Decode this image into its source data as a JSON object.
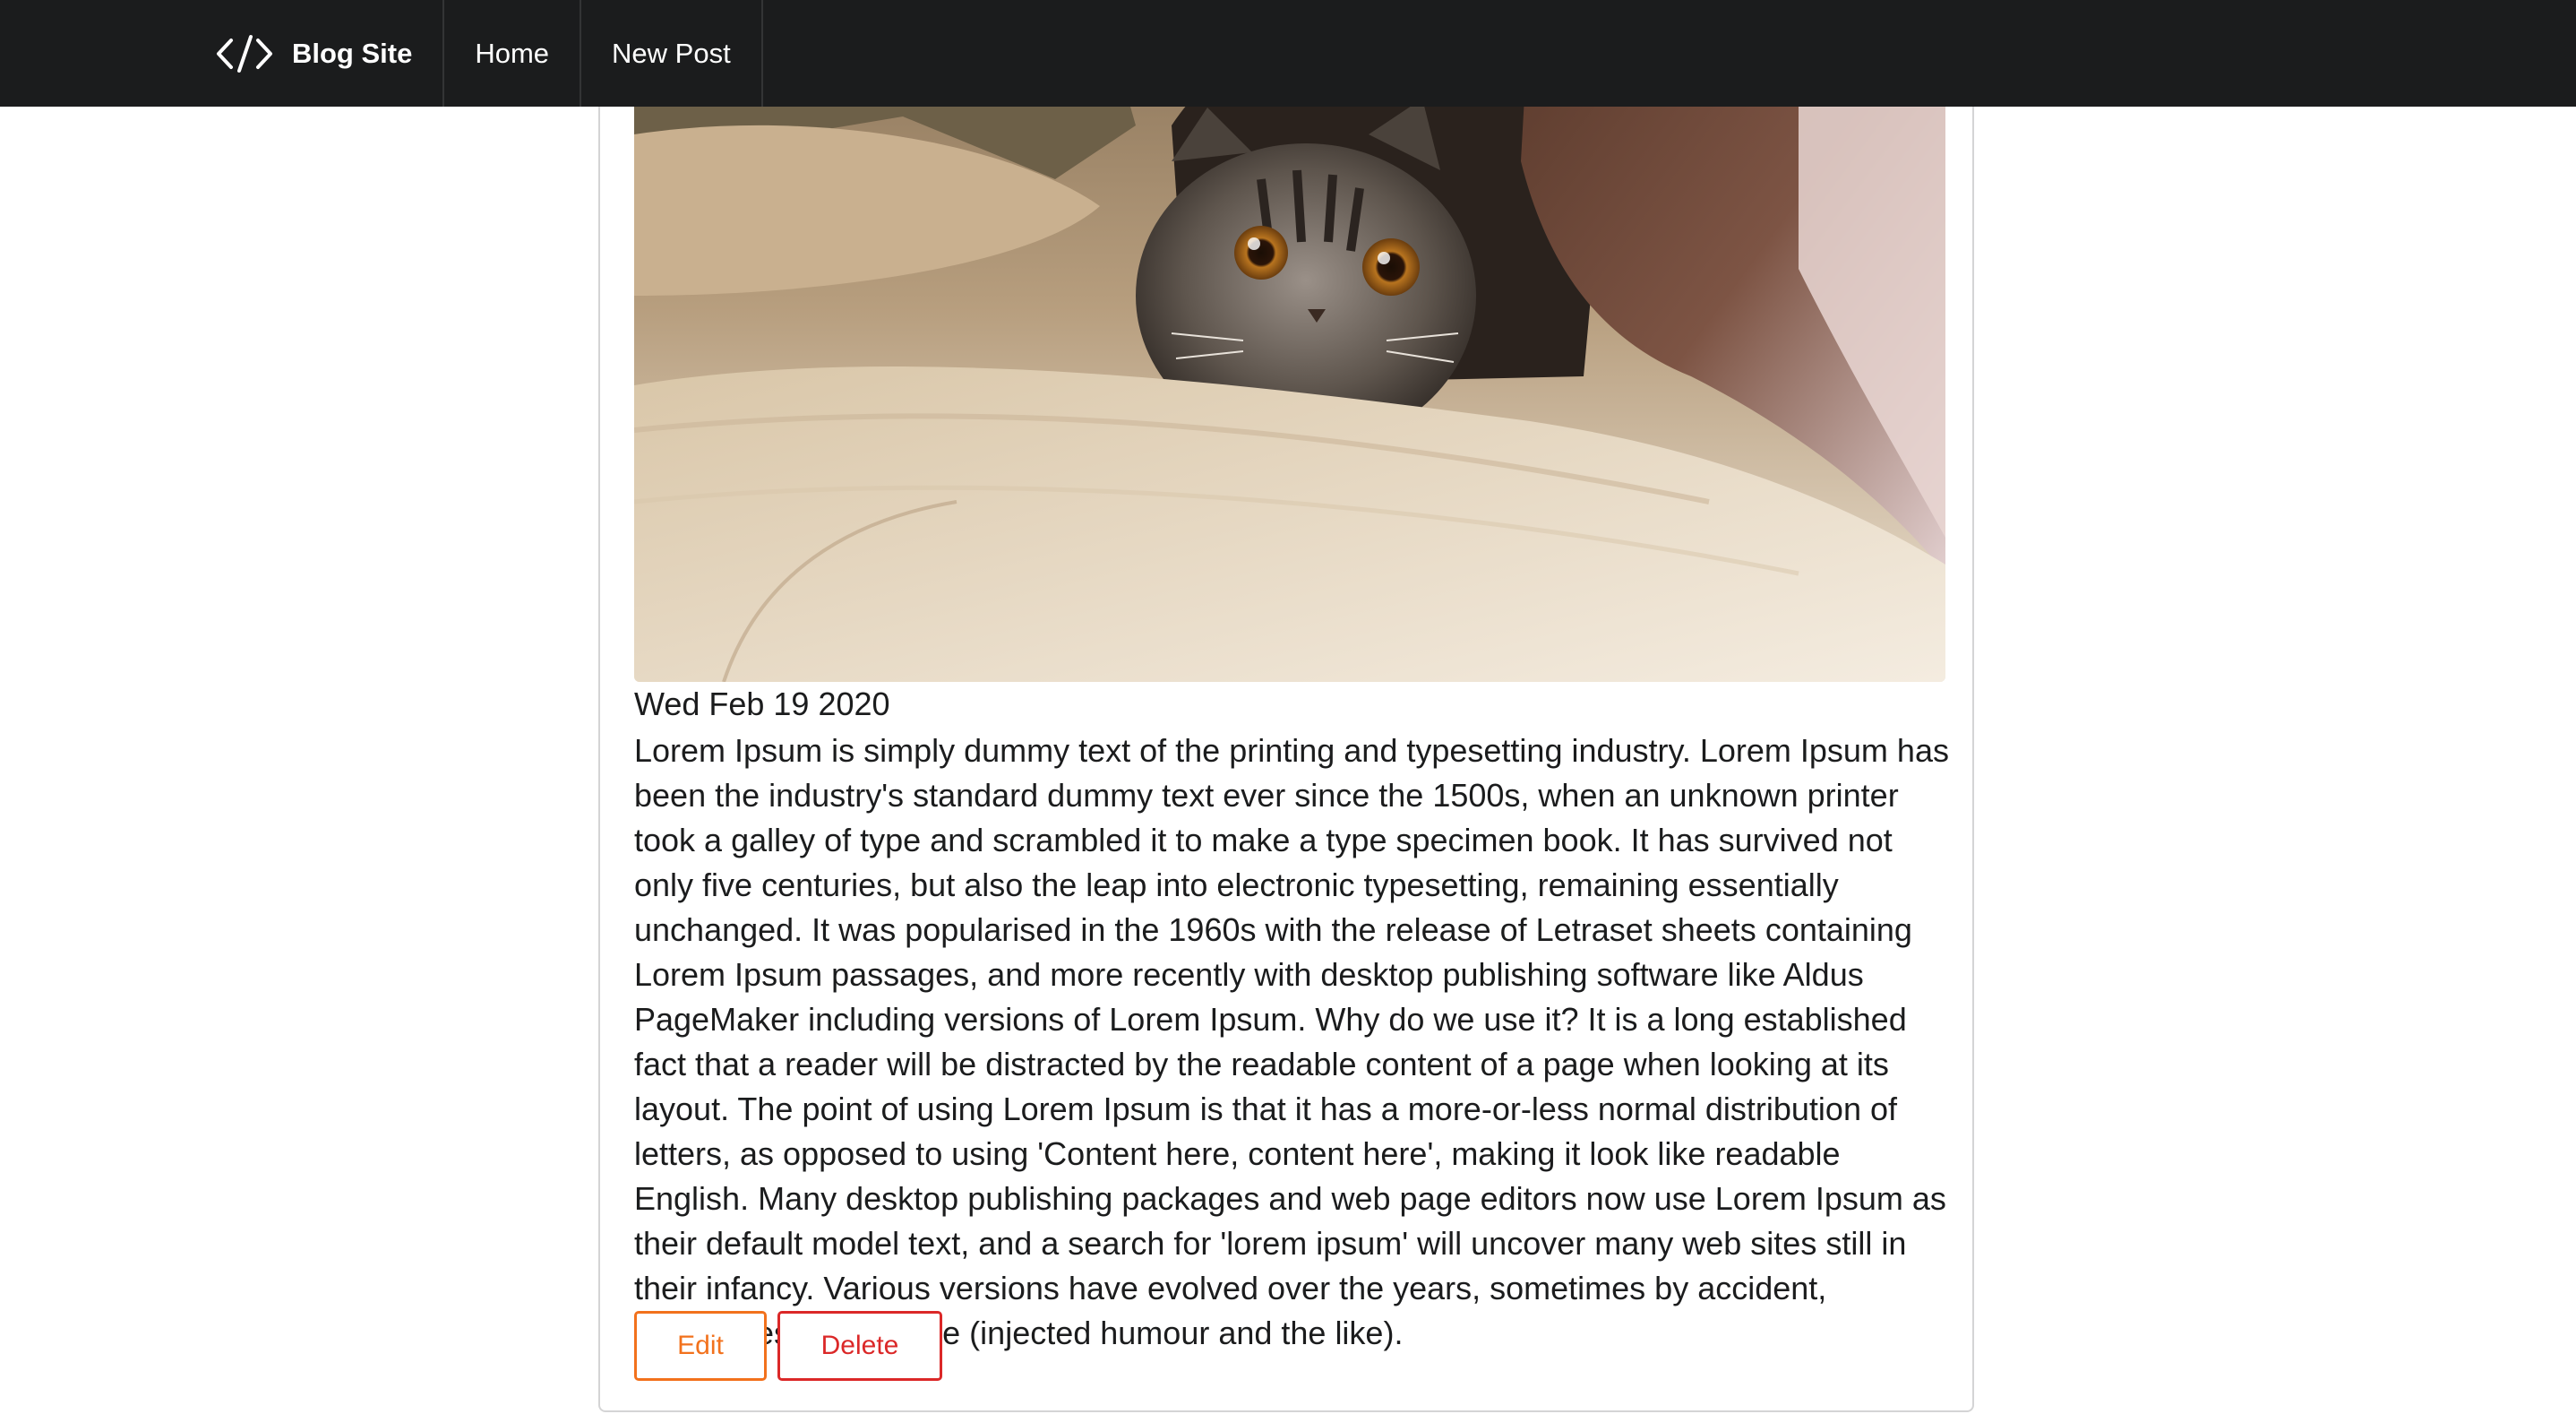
{
  "navbar": {
    "brand_icon": "code-icon",
    "brand_label": "Blog Site",
    "items": [
      {
        "label": "Home"
      },
      {
        "label": "New Post"
      }
    ]
  },
  "post": {
    "image_subject": "cat-photo",
    "date": "Wed Feb 19 2020",
    "body": "Lorem Ipsum is simply dummy text of the printing and typesetting industry. Lorem Ipsum has been the industry's standard dummy text ever since the 1500s, when an unknown printer took a galley of type and scrambled it to make a type specimen book. It has survived not only five centuries, but also the leap into electronic typesetting, remaining essentially unchanged. It was popularised in the 1960s with the release of Letraset sheets containing Lorem Ipsum passages, and more recently with desktop publishing software like Aldus PageMaker including versions of Lorem Ipsum. Why do we use it? It is a long established fact that a reader will be distracted by the readable content of a page when looking at its layout. The point of using Lorem Ipsum is that it has a more-or-less normal distribution of letters, as opposed to using 'Content here, content here', making it look like readable English. Many desktop publishing packages and web page editors now use Lorem Ipsum as their default model text, and a search for 'lorem ipsum' will uncover many web sites still in their infancy. Various versions have evolved over the years, sometimes by accident, sometimes on purpose (injected humour and the like).",
    "actions": {
      "edit_label": "Edit",
      "delete_label": "Delete"
    }
  },
  "colors": {
    "navbar_bg": "#1b1c1d",
    "edit": "#f2711c",
    "delete": "#db2828"
  }
}
